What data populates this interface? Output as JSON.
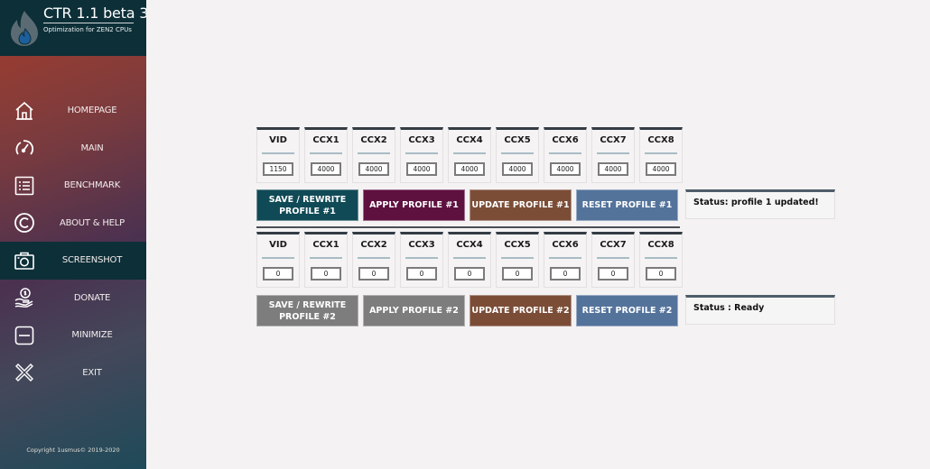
{
  "app": {
    "title": "CTR 1.1 beta 3",
    "subtitle": "Optimization for ZEN2 CPUs",
    "copyright": "Copyright 1usmus© 2019-2020"
  },
  "sidebar": {
    "items": [
      {
        "label": "HOMEPAGE",
        "icon": "home-icon",
        "active": false
      },
      {
        "label": "MAIN",
        "icon": "speedometer-icon",
        "active": false
      },
      {
        "label": "BENCHMARK",
        "icon": "list-icon",
        "active": false
      },
      {
        "label": "ABOUT & HELP",
        "icon": "copyright-icon",
        "active": false
      },
      {
        "label": "SCREENSHOT",
        "icon": "camera-icon",
        "active": true
      },
      {
        "label": "DONATE",
        "icon": "donate-hand-icon",
        "active": false
      },
      {
        "label": "MINIMIZE",
        "icon": "minimize-icon",
        "active": false
      },
      {
        "label": "EXIT",
        "icon": "close-icon",
        "active": false
      }
    ]
  },
  "profiles": [
    {
      "cells": [
        {
          "label": "VID",
          "value": "1150"
        },
        {
          "label": "CCX1",
          "value": "4000"
        },
        {
          "label": "CCX2",
          "value": "4000"
        },
        {
          "label": "CCX3",
          "value": "4000"
        },
        {
          "label": "CCX4",
          "value": "4000"
        },
        {
          "label": "CCX5",
          "value": "4000"
        },
        {
          "label": "CCX6",
          "value": "4000"
        },
        {
          "label": "CCX7",
          "value": "4000"
        },
        {
          "label": "CCX8",
          "value": "4000"
        }
      ],
      "buttons": {
        "save": "SAVE / REWRITE PROFILE #1",
        "apply": "APPLY PROFILE #1",
        "update": "UPDATE PROFILE #1",
        "reset": "RESET PROFILE #1"
      },
      "button_colors": {
        "save": "#104a56",
        "apply": "#5e103f",
        "update": "#7b4d37",
        "reset": "#54739b"
      },
      "status": "Status: profile 1 updated!"
    },
    {
      "cells": [
        {
          "label": "VID",
          "value": "0"
        },
        {
          "label": "CCX1",
          "value": "0"
        },
        {
          "label": "CCX2",
          "value": "0"
        },
        {
          "label": "CCX3",
          "value": "0"
        },
        {
          "label": "CCX4",
          "value": "0"
        },
        {
          "label": "CCX5",
          "value": "0"
        },
        {
          "label": "CCX6",
          "value": "0"
        },
        {
          "label": "CCX7",
          "value": "0"
        },
        {
          "label": "CCX8",
          "value": "0"
        }
      ],
      "buttons": {
        "save": "SAVE / REWRITE PROFILE #2",
        "apply": "APPLY PROFILE #2",
        "update": "UPDATE PROFILE #2",
        "reset": "RESET PROFILE #2"
      },
      "button_colors": {
        "save": "#7d7d7d",
        "apply": "#7d7d7d",
        "update": "#7b4d37",
        "reset": "#54739b"
      },
      "status": "Status : Ready"
    }
  ]
}
